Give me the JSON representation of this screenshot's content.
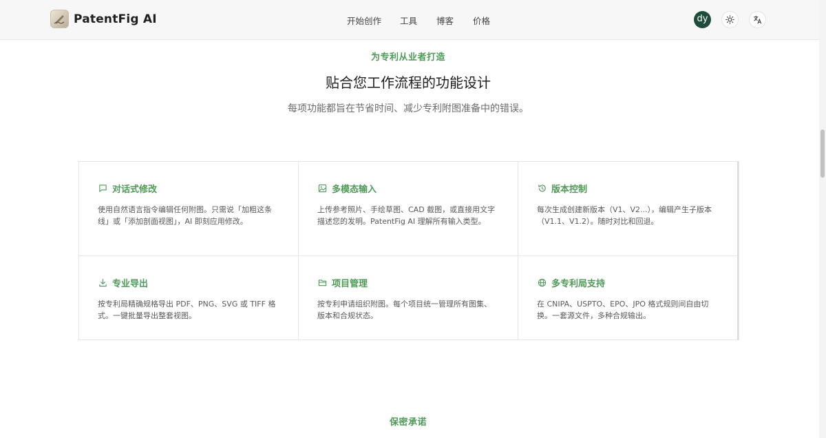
{
  "header": {
    "brand": "PatentFig AI",
    "nav": [
      "开始创作",
      "工具",
      "博客",
      "价格"
    ],
    "avatar_initials": "dy",
    "theme_icon": "sun-icon",
    "language_icon": "translate-icon"
  },
  "hero": {
    "eyebrow": "为专利从业者打造",
    "title": "贴合您工作流程的功能设计",
    "subtitle": "每项功能都旨在节省时间、减少专利附图准备中的错误。"
  },
  "features": [
    {
      "icon": "chat-bubble-icon",
      "title": "对话式修改",
      "desc": "使用自然语言指令编辑任何附图。只需说「加粗这条线」或「添加剖面视图」，AI 即刻应用修改。"
    },
    {
      "icon": "image-icon",
      "title": "多模态输入",
      "desc": "上传参考照片、手绘草图、CAD 截图，或直接用文字描述您的发明。PatentFig AI 理解所有输入类型。"
    },
    {
      "icon": "history-icon",
      "title": "版本控制",
      "desc": "每次生成创建新版本（V1、V2...），编辑产生子版本（V1.1、V1.2）。随时对比和回退。"
    },
    {
      "icon": "download-icon",
      "title": "专业导出",
      "desc": "按专利局精确规格导出 PDF、PNG、SVG 或 TIFF 格式。一键批量导出整套视图。"
    },
    {
      "icon": "folder-icon",
      "title": "项目管理",
      "desc": "按专利申请组织附图。每个项目统一管理所有图集、版本和合规状态。"
    },
    {
      "icon": "globe-icon",
      "title": "多专利局支持",
      "desc": "在 CNIPA、USPTO、EPO、JPO 格式规则间自由切换。一套源文件，多种合规输出。"
    }
  ],
  "next_section": {
    "eyebrow": "保密承诺"
  },
  "colors": {
    "accent": "#4e9a56",
    "avatar_bg": "#1f4d3c"
  }
}
